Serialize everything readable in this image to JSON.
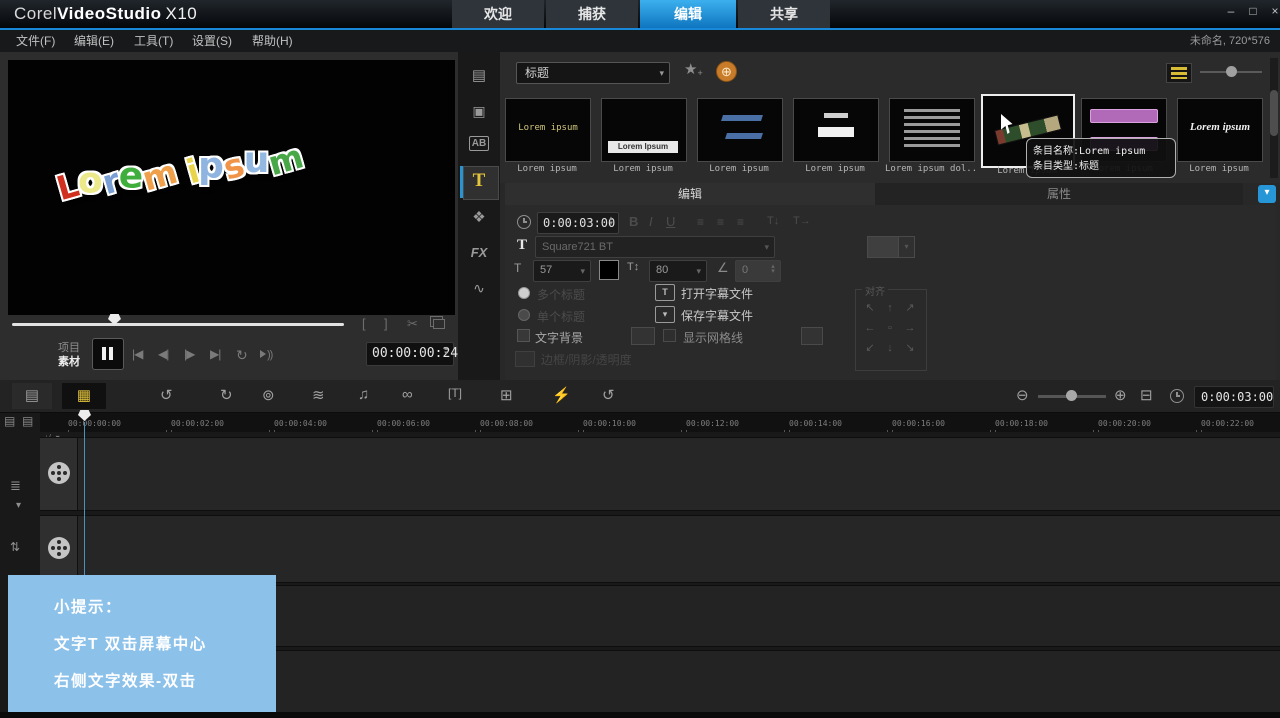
{
  "window": {
    "corel": "Corel",
    "product": "VideoStudio",
    "version": "X10",
    "tab_welcome": "欢迎",
    "tab_capture": "捕获",
    "tab_edit": "编辑",
    "tab_share": "共享"
  },
  "menubar": {
    "file": "文件(F)",
    "edit": "编辑(E)",
    "tools": "工具(T)",
    "settings": "设置(S)",
    "help": "帮助(H)",
    "project_info": "未命名, 720*576"
  },
  "preview": {
    "letters": [
      {
        "ch": "L",
        "c": "#d03020"
      },
      {
        "ch": "o",
        "c": "#ece98a"
      },
      {
        "ch": "r",
        "c": "#7a9fd4"
      },
      {
        "ch": "e",
        "c": "#3fae3c"
      },
      {
        "ch": "m",
        "c": "#f0a04a"
      },
      {
        "ch": " "
      },
      {
        "ch": "i",
        "c": "#e8d44d"
      },
      {
        "ch": "p",
        "c": "#8fb4e0"
      },
      {
        "ch": "s",
        "c": "#f0944a"
      },
      {
        "ch": "u",
        "c": "#93b8e2"
      },
      {
        "ch": "m",
        "c": "#48a848"
      }
    ],
    "mode_project": "项目",
    "mode_clip": "素材",
    "timecode": "00:00:00:24"
  },
  "library": {
    "category": "标题",
    "captions": [
      "Lorem ipsum",
      "Lorem ipsum",
      "Lorem ipsum",
      "Lorem ipsum",
      "Lorem ipsum dol...",
      "Lorem ipsum",
      "Lorem ipsum",
      "Lorem ipsum"
    ],
    "thumb1_text": "Lorem ipsum",
    "thumb2_text": "Lorem Ipsum",
    "thumb8_text": "Lorem ipsum",
    "tooltip_name": "条目名称:Lorem ipsum",
    "tooltip_type": "条目类型:标题"
  },
  "options": {
    "tab_edit": "编辑",
    "tab_attr": "属性",
    "duration": "0:00:03:00",
    "font_name": "Square721 BT",
    "font_size": "57",
    "line_spacing": "80",
    "rotation": "0",
    "radio_multi": "多个标题",
    "radio_single": "单个标题",
    "open_subtitle": "打开字幕文件",
    "save_subtitle": "保存字幕文件",
    "text_backdrop": "文字背景",
    "show_grid": "显示网格线",
    "border_shadow": "边框/阴影/透明度",
    "align_legend": "对齐"
  },
  "timeline": {
    "ruler": [
      "00:00:00:00",
      "00:00:02:00",
      "00:00:04:00",
      "00:00:06:00",
      "00:00:08:00",
      "00:00:10:00",
      "00:00:12:00",
      "00:00:14:00",
      "00:00:16:00",
      "00:00:18:00",
      "00:00:20:00",
      "00:00:22:00"
    ],
    "timecode": "0:00:03:00"
  },
  "tip": {
    "title": "小提示：",
    "line2": "文字T 双击屏幕中心",
    "line3": "右侧文字效果-双击"
  },
  "icons": {
    "min": "–",
    "max": "□",
    "close": "×",
    "caret_down": "▾",
    "caret_up": "▴",
    "star": "★",
    "plus": "+",
    "globe": "⊕",
    "media": "▤",
    "instant_project": "▣",
    "transition": "AB",
    "title": "T",
    "graphic": "❖",
    "filter": "FX",
    "path": "∿",
    "mark_in": "[",
    "mark_out": "]",
    "split": "✂",
    "home": "|◀",
    "prev_frame": "◀|",
    "next_frame": "|▶",
    "end": "▶|",
    "repeat": "↻",
    "storyboard": "▤",
    "timeline_view": "▦",
    "undo": "↺",
    "redo": "↻",
    "record": "⊚",
    "mixer": "≋",
    "auto_music": "♫",
    "transition_circles": "∞",
    "subtitle": "[T]",
    "multicam": "⊞",
    "tracking": "⚡",
    "time_remap": "↺",
    "zoom_out": "⊖",
    "zoom_in": "⊕",
    "fit": "⊟",
    "align": [
      "↖",
      "↑",
      "↗",
      "←",
      "▫",
      "→",
      "↙",
      "↓",
      "↘"
    ],
    "bold": "B",
    "italic": "I",
    "underline": "U",
    "align_left": "≡",
    "align_center": "≡",
    "align_right": "≡",
    "vertical_text": "T↓",
    "horizontal_text": "T→",
    "size_T": "T",
    "spacing_T": "T↕",
    "angle": "∠",
    "track_list": "≣",
    "chevron_down": "▾",
    "swap": "⇅",
    "ruler_icon": "▤",
    "plus_minus": "+/−▾"
  }
}
